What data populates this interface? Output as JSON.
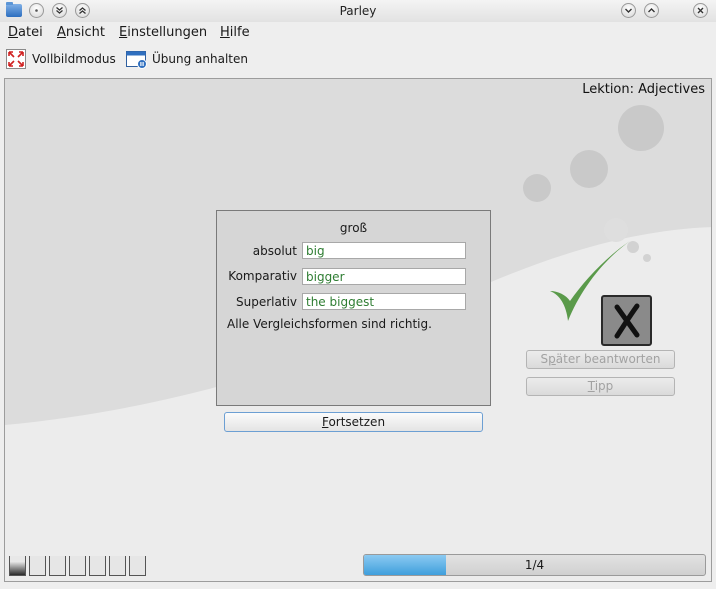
{
  "window": {
    "title": "Parley"
  },
  "menu": [
    {
      "label": "Datei",
      "mnemonic": "D",
      "rest": "atei"
    },
    {
      "label": "Ansicht",
      "mnemonic": "A",
      "rest": "nsicht"
    },
    {
      "label": "Einstellungen",
      "mnemonic": "E",
      "rest": "instellungen"
    },
    {
      "label": "Hilfe",
      "mnemonic": "H",
      "rest": "ilfe"
    }
  ],
  "toolbar": {
    "fullscreen_label": "Vollbildmodus",
    "pause_label": "Übung anhalten"
  },
  "lesson": {
    "label": "Lektion: Adjectives"
  },
  "question": {
    "word": "groß",
    "rows": [
      {
        "label": "absolut",
        "value": "big"
      },
      {
        "label": "Komparativ",
        "value": "bigger"
      },
      {
        "label": "Superlativ",
        "value": "the biggest"
      }
    ],
    "result": "Alle Vergleichsformen sind richtig."
  },
  "buttons": {
    "continue": {
      "mnemonic": "F",
      "rest": "ortsetzen"
    },
    "answer_later": {
      "mnemonic": "",
      "pre": "S",
      "accel": "p",
      "post": "äter beantworten"
    },
    "hint": {
      "mnemonic": "T",
      "rest": "ipp"
    }
  },
  "status": {
    "correct": true
  },
  "boxes": {
    "count": 7
  },
  "progress": {
    "text": "1/4",
    "fraction": 0.24
  },
  "colors": {
    "correct_green": "#5a9a4a",
    "answer_text": "#2e7d32",
    "progress_fill": "#3f9fdc"
  },
  "icons": [
    "folder-icon",
    "fullscreen-icon",
    "pause-icon",
    "checkmark-icon",
    "x-mark-icon"
  ]
}
